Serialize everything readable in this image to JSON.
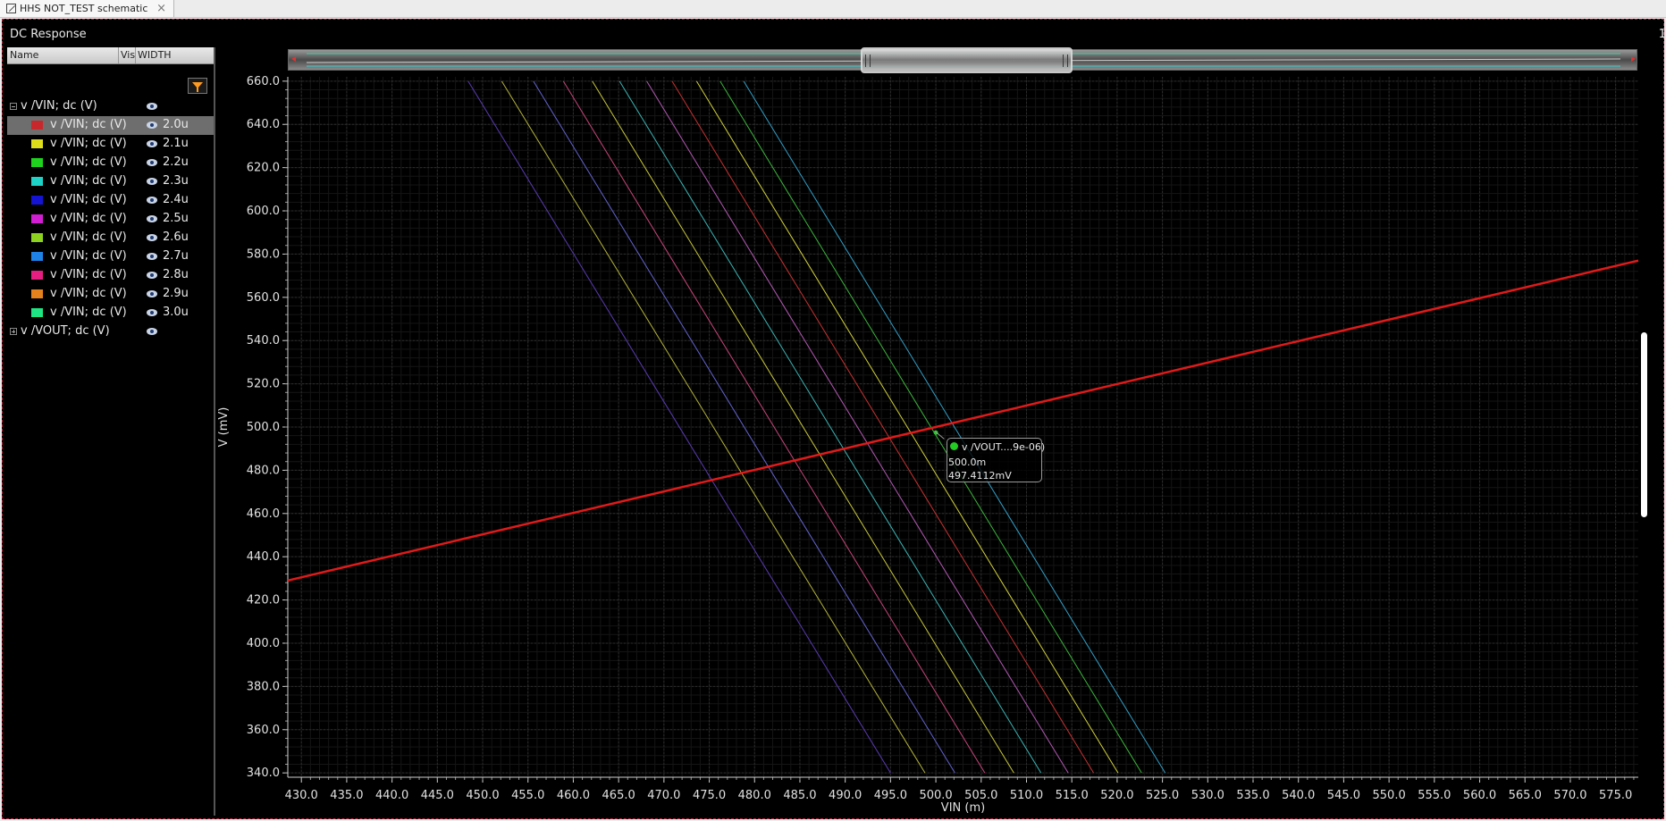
{
  "tab": {
    "title": "HHS NOT_TEST schematic",
    "close": "×"
  },
  "window": {
    "title": "DC Response",
    "corner_text": "1"
  },
  "panel": {
    "columns": {
      "name": "Name",
      "vis": "Vis",
      "width": "WIDTH"
    },
    "group_vin": {
      "label": "v /VIN; dc (V)"
    },
    "group_vout": {
      "label": "v /VOUT; dc (V)"
    },
    "traces": [
      {
        "label": "v /VIN; dc (V)",
        "width": "2.0u",
        "color": "#c8282c"
      },
      {
        "label": "v /VIN; dc (V)",
        "width": "2.1u",
        "color": "#dede1a"
      },
      {
        "label": "v /VIN; dc (V)",
        "width": "2.2u",
        "color": "#1ed21e"
      },
      {
        "label": "v /VIN; dc (V)",
        "width": "2.3u",
        "color": "#1ed2c8"
      },
      {
        "label": "v /VIN; dc (V)",
        "width": "2.4u",
        "color": "#1414d2"
      },
      {
        "label": "v /VIN; dc (V)",
        "width": "2.5u",
        "color": "#d21ed2"
      },
      {
        "label": "v /VIN; dc (V)",
        "width": "2.6u",
        "color": "#8cd21e"
      },
      {
        "label": "v /VIN; dc (V)",
        "width": "2.7u",
        "color": "#1e82e6"
      },
      {
        "label": "v /VIN; dc (V)",
        "width": "2.8u",
        "color": "#e61e82"
      },
      {
        "label": "v /VIN; dc (V)",
        "width": "2.9u",
        "color": "#e6821e"
      },
      {
        "label": "v /VIN; dc (V)",
        "width": "3.0u",
        "color": "#1ee682"
      }
    ]
  },
  "marker": {
    "title": "v /VOUT....9e-06)",
    "x_value": "500.0m",
    "y_value": "497.4112mV"
  },
  "chart_data": {
    "type": "line",
    "xlabel": "VIN (m)",
    "ylabel": "V (mV)",
    "xlim": [
      428.5,
      577.5
    ],
    "ylim": [
      338,
      662
    ],
    "xticks": [
      "430.0",
      "435.0",
      "440.0",
      "445.0",
      "450.0",
      "455.0",
      "460.0",
      "465.0",
      "470.0",
      "475.0",
      "480.0",
      "485.0",
      "490.0",
      "495.0",
      "500.0",
      "505.0",
      "510.0",
      "515.0",
      "520.0",
      "525.0",
      "530.0",
      "535.0",
      "540.0",
      "545.0",
      "550.0",
      "555.0",
      "560.0",
      "565.0",
      "570.0",
      "575.0"
    ],
    "yticks": [
      "340.0",
      "360.0",
      "380.0",
      "400.0",
      "420.0",
      "440.0",
      "460.0",
      "480.0",
      "500.0",
      "520.0",
      "540.0",
      "560.0",
      "580.0",
      "600.0",
      "620.0",
      "640.0",
      "660.0"
    ],
    "series": [
      {
        "color": "#e01a1a",
        "x": [
          428.5,
          577.5
        ],
        "y": [
          429,
          577
        ]
      },
      {
        "color": "#5a3cb4",
        "x": [
          448.4,
          495.0
        ],
        "y": [
          660,
          340
        ]
      },
      {
        "color": "#b4b43c",
        "x": [
          452.1,
          498.8
        ],
        "y": [
          660,
          340
        ]
      },
      {
        "color": "#6464d2",
        "x": [
          455.6,
          502.1
        ],
        "y": [
          660,
          340
        ]
      },
      {
        "color": "#c84678",
        "x": [
          458.9,
          505.4
        ],
        "y": [
          660,
          340
        ]
      },
      {
        "color": "#c8c83c",
        "x": [
          462.1,
          508.6
        ],
        "y": [
          660,
          340
        ]
      },
      {
        "color": "#3cb4b4",
        "x": [
          465.1,
          511.6
        ],
        "y": [
          660,
          340
        ]
      },
      {
        "color": "#b45ab4",
        "x": [
          468.1,
          514.6
        ],
        "y": [
          660,
          340
        ]
      },
      {
        "color": "#c83232",
        "x": [
          470.9,
          517.4
        ],
        "y": [
          660,
          340
        ]
      },
      {
        "color": "#d2d23c",
        "x": [
          473.6,
          520.1
        ],
        "y": [
          660,
          340
        ]
      },
      {
        "color": "#3cb43c",
        "x": [
          476.2,
          522.7
        ],
        "y": [
          660,
          340
        ]
      },
      {
        "color": "#32a0c8",
        "x": [
          478.8,
          525.3
        ],
        "y": [
          660,
          340
        ]
      }
    ]
  }
}
